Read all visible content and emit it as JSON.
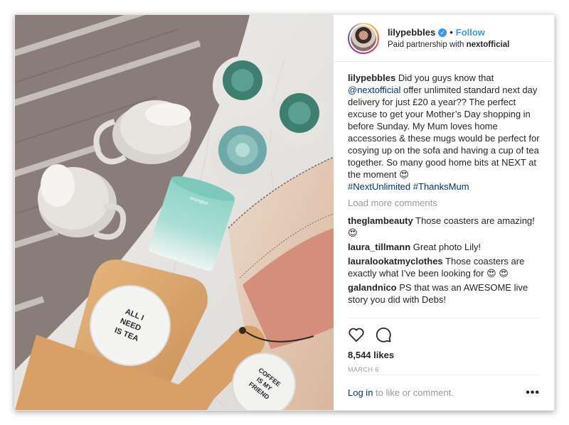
{
  "header": {
    "username": "lilypebbles",
    "verified_mark": "✓",
    "separator": "•",
    "follow_label": "Follow",
    "partnership_prefix": "Paid partnership with ",
    "partner": "nextofficial"
  },
  "caption": {
    "username": "lilypebbles",
    "text_1": " Did you guys know that ",
    "mention": "@nextofficial",
    "text_2": " offer unlimited standard next day delivery for just £20 a year?? The perfect excuse to get your Mother’s Day shopping in before Sunday. My Mum loves home accessories & these mugs would be perfect for cosying up on the sofa and having a cup of tea together. So many good home bits at NEXT at the moment 😍",
    "hashtag_1": "#NextUnlimited",
    "hashtag_2": "#ThanksMum"
  },
  "load_more_label": "Load more comments",
  "comments": [
    {
      "username": "theglambeauty",
      "text": " Those coasters are amazing! 😍"
    },
    {
      "username": "laura_tillmann",
      "text": " Great photo Lily!"
    },
    {
      "username": "lauralookatmyclothes",
      "text": " Those coasters are exactly what I’ve been looking for 😍 😍"
    },
    {
      "username": "galandnico",
      "text": " PS that was an AWESOME live story you did with Debs!"
    }
  ],
  "actions": {
    "like_icon": "heart-icon",
    "comment_icon": "comment-icon",
    "likes": "8,544 likes",
    "date": "MARCH 6"
  },
  "footer": {
    "login_label": "Log in",
    "rest": " to like or comment.",
    "more_icon": "•••"
  },
  "photo": {
    "coaster_1_text": [
      "ALL I",
      "NEED",
      "IS TEA"
    ],
    "coaster_2_text": [
      "COFFEE",
      "IS MY",
      "FRIEND"
    ],
    "candle_label": "energise"
  },
  "colors": {
    "link": "#003569",
    "follow": "#3897f0",
    "muted": "#999999"
  }
}
